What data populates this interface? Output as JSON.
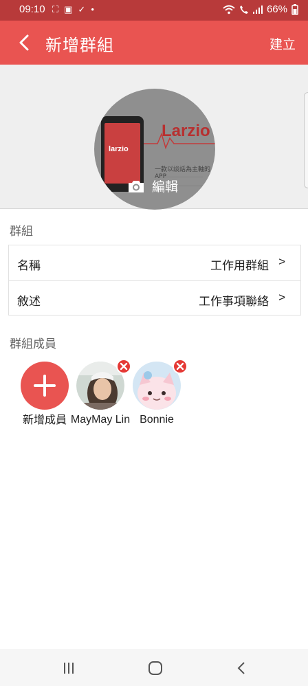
{
  "status": {
    "time": "09:10",
    "battery": "66%"
  },
  "app_bar": {
    "title": "新增群組",
    "create_label": "建立"
  },
  "avatar": {
    "edit_label": "編輯",
    "screen_logo": "larzio",
    "logo_text": "Larzio",
    "tagline": "一款以談話為主軸的APP"
  },
  "group_section": {
    "title": "群組",
    "rows": [
      {
        "label": "名稱",
        "value": "工作用群組",
        "chevron": ">"
      },
      {
        "label": "敘述",
        "value": "工作事項聯絡",
        "chevron": ">"
      }
    ]
  },
  "members_section": {
    "title": "群組成員",
    "add_label": "新增成員",
    "members": [
      {
        "name": "MayMay Lin"
      },
      {
        "name": "Bonnie"
      }
    ]
  },
  "colors": {
    "app_bar": "#e95451",
    "status_bar": "#b83a3a",
    "add_button": "#e95451",
    "remove_badge": "#e53935"
  }
}
